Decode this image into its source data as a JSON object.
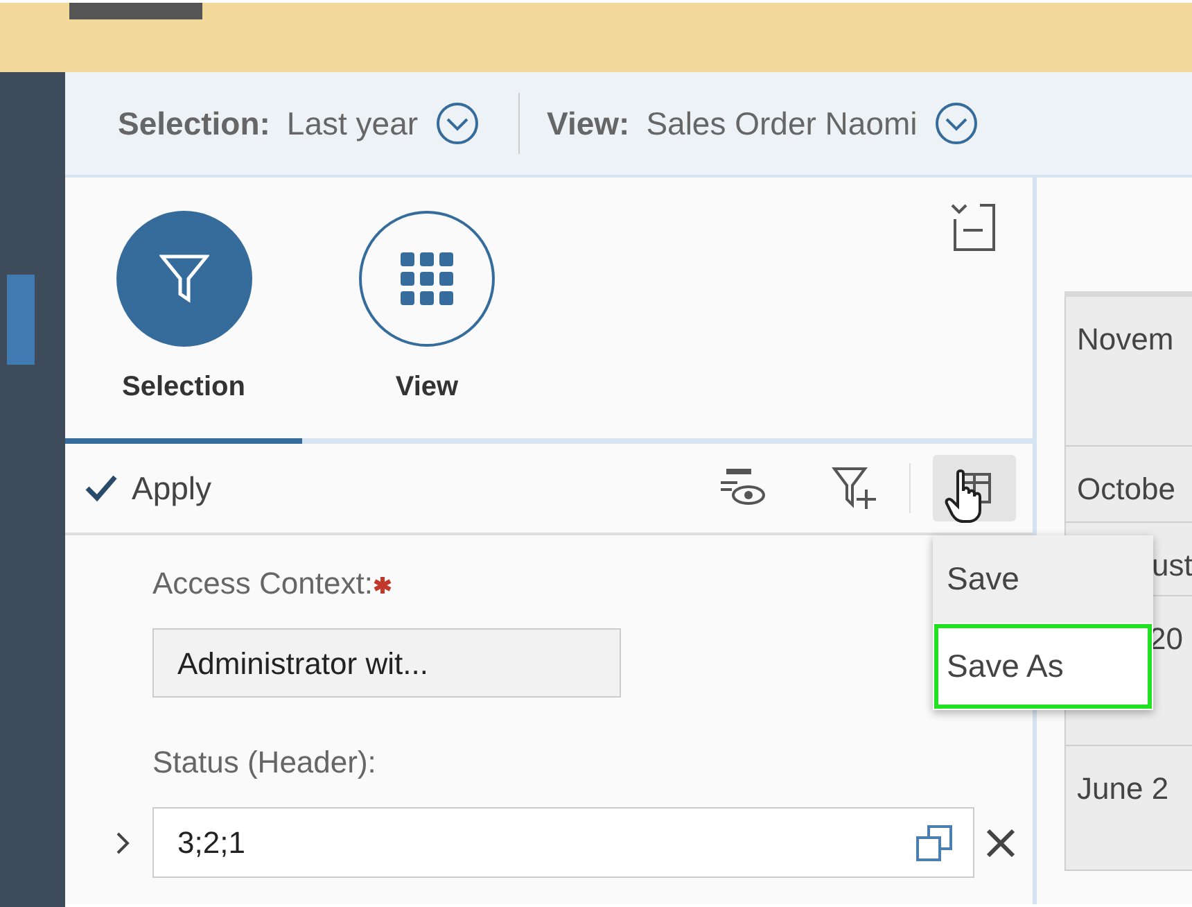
{
  "context_bar": [
    {
      "label": "Selection:",
      "value": "Last year"
    },
    {
      "label": "View:",
      "value": "Sales Order Naomi"
    }
  ],
  "tabs": [
    {
      "label": "Selection",
      "selected": true,
      "kind": "filter"
    },
    {
      "label": "View",
      "selected": false,
      "kind": "grid"
    }
  ],
  "toolbar": {
    "apply": "Apply"
  },
  "fields": [
    {
      "label": "Access Context:",
      "required": true,
      "kind": "readonly",
      "value": "Administrator wit..."
    },
    {
      "label": "Status (Header):",
      "required": false,
      "kind": "input",
      "value": "3;2;1",
      "expanded": false
    }
  ],
  "menu": [
    {
      "label": "Save",
      "hovered": true,
      "outlined": false
    },
    {
      "label": "Save As",
      "hovered": false,
      "outlined": true
    }
  ],
  "table": {
    "rows": [
      "Novem",
      "Octobe",
      "ust",
      "20",
      "June 2"
    ]
  }
}
